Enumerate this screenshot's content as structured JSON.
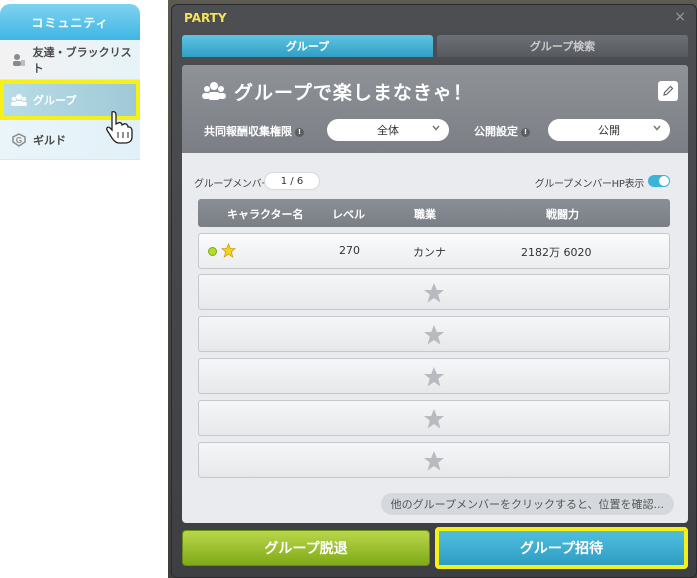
{
  "community": {
    "header": "コミュニティ",
    "items": [
      {
        "label": "友達・ブラックリスト",
        "icon": "friend-icon"
      },
      {
        "label": "グループ",
        "icon": "group-icon"
      },
      {
        "label": "ギルド",
        "icon": "guild-icon"
      }
    ]
  },
  "party": {
    "title": "PARTY",
    "close": "×",
    "tabs": [
      {
        "label": "グループ",
        "active": true
      },
      {
        "label": "グループ検索",
        "active": false
      }
    ],
    "group_name": "グループで楽しまなきゃ！",
    "settings": {
      "reward_label": "共同報酬収集権限",
      "reward_value": "全体",
      "public_label": "公開設定",
      "public_value": "公開"
    },
    "member_list_label": "グループメンバーリスト",
    "member_count": "1 / 6",
    "hp_display_label": "グループメンバーHP表示",
    "hp_display_on": true,
    "columns": [
      "キャラクター名",
      "レベル",
      "職業",
      "戦闘力"
    ],
    "members": [
      {
        "name": "",
        "level": "270",
        "job": "カンナ",
        "power": "2182万 6020",
        "online": true,
        "leader": true
      }
    ],
    "empty_slots": 5,
    "hint": "他のグループメンバーをクリックすると、位置を確認...",
    "leave_button": "グループ脱退",
    "invite_button": "グループ招待"
  },
  "colors": {
    "accent": "#3fb6e4",
    "highlight": "#f5ef1a",
    "leave_green": "#8fb81f",
    "title_yellow": "#f4e25a"
  }
}
